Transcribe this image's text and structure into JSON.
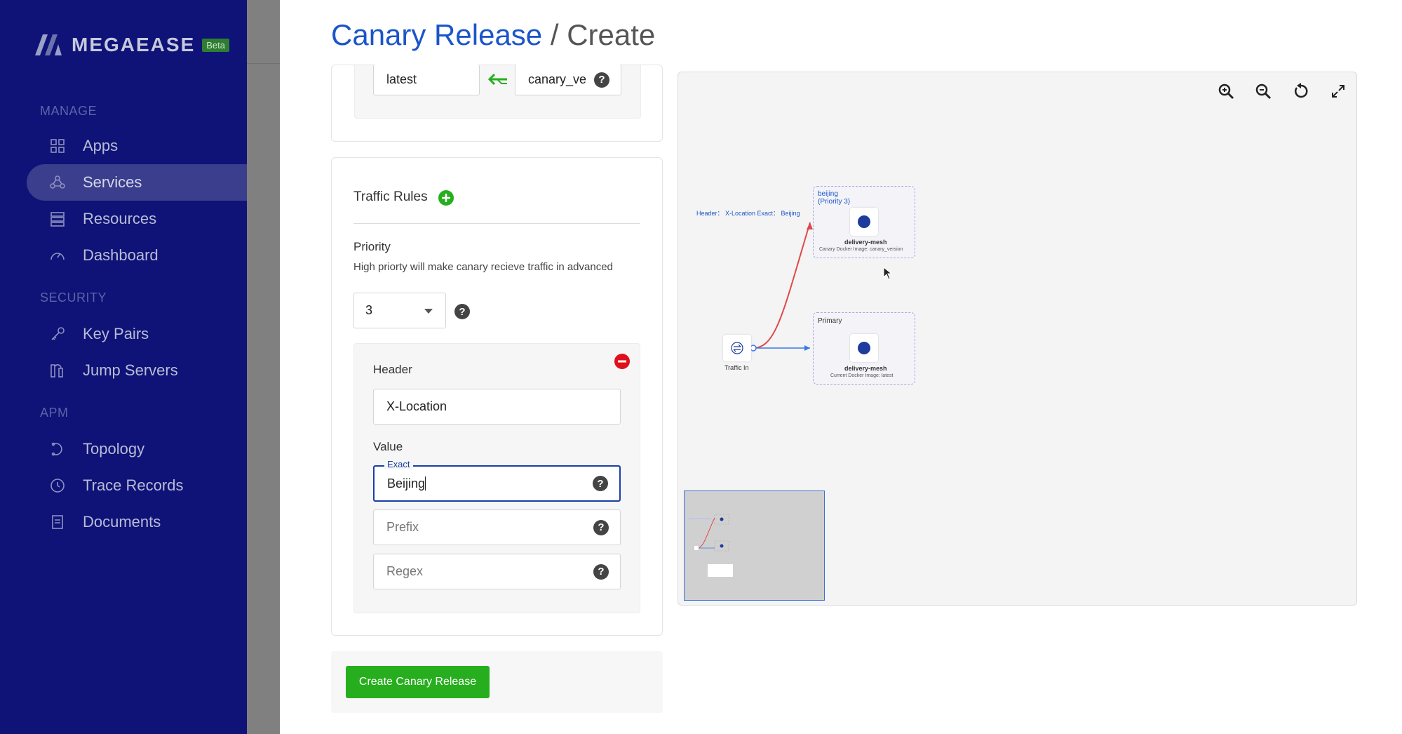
{
  "app": {
    "brand": "MEGAEASE",
    "beta": "Beta"
  },
  "sidebar": {
    "manage_title": "MANAGE",
    "manage": [
      {
        "label": "Apps",
        "icon": "grid-icon"
      },
      {
        "label": "Services",
        "icon": "services-icon",
        "active": true
      },
      {
        "label": "Resources",
        "icon": "server-icon"
      },
      {
        "label": "Dashboard",
        "icon": "gauge-icon"
      }
    ],
    "security_title": "SECURITY",
    "security": [
      {
        "label": "Key Pairs",
        "icon": "key-icon"
      },
      {
        "label": "Jump Servers",
        "icon": "jump-server-icon"
      }
    ],
    "apm_title": "APM",
    "apm": [
      {
        "label": "Topology",
        "icon": "topology-icon"
      },
      {
        "label": "Trace Records",
        "icon": "clock-icon"
      },
      {
        "label": "Documents",
        "icon": "document-icon"
      }
    ]
  },
  "page": {
    "title_main": "Canary Release",
    "title_sep": " / ",
    "title_sub": "Create"
  },
  "version_map": {
    "left_value": "latest",
    "right_value": "canary_ve"
  },
  "traffic_rules": {
    "title": "Traffic Rules",
    "priority_label": "Priority",
    "priority_hint": "High priorty will make canary recieve traffic in advanced",
    "priority_value": "3",
    "header_label": "Header",
    "header_value": "X-Location",
    "value_label": "Value",
    "exact_label": "Exact",
    "exact_value": "Beijing",
    "prefix_placeholder": "Prefix",
    "regex_placeholder": "Regex"
  },
  "create_button": "Create Canary Release",
  "graph": {
    "edge_label": "Header： X-Location   Exact： Beijing",
    "canary_group": {
      "title": "beijing",
      "subtitle": "(Priority 3)",
      "node": "delivery-mesh",
      "caption": "Canary Docker Image: canary_version"
    },
    "primary_group": {
      "title": "Primary",
      "node": "delivery-mesh",
      "caption": "Current Docker Image: latest"
    },
    "traffic_in": "Traffic In",
    "colors": {
      "canary_edge": "#e04848",
      "primary_edge": "#3b78e7",
      "node": "#1d3c9c"
    }
  }
}
